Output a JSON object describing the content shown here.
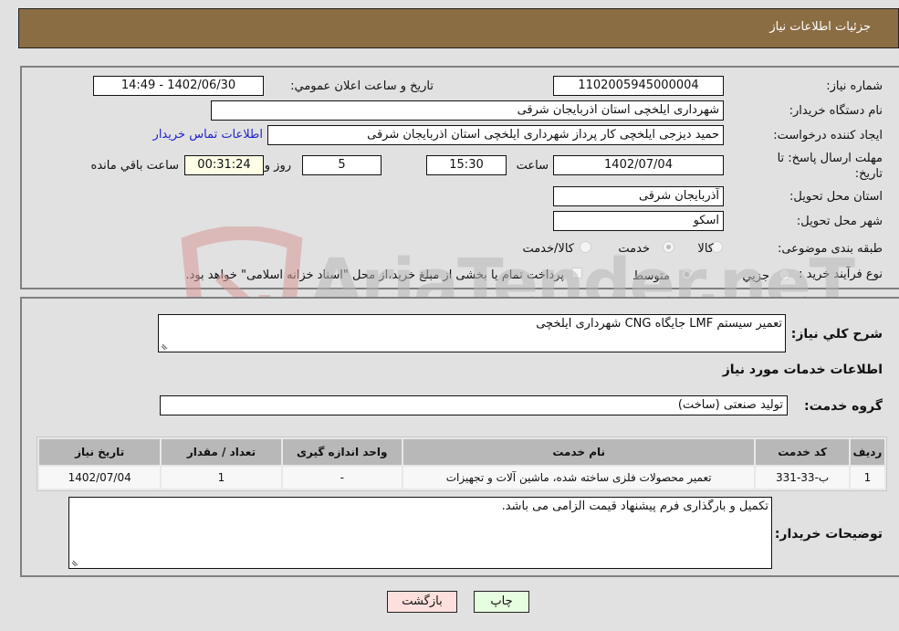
{
  "header": {
    "title": "جزئیات اطلاعات نیاز"
  },
  "form": {
    "need_number": {
      "label": "شماره نیاز:",
      "value": "1102005945000004"
    },
    "announce_datetime": {
      "label": "تاریخ و ساعت اعلان عمومي:",
      "value": "1402/06/30 - 14:49"
    },
    "buyer_org": {
      "label": "نام دستگاه خریدار:",
      "value": "شهرداری ایلخچی استان اذربایجان شرقی"
    },
    "requester": {
      "label": "ایجاد کننده درخواست:",
      "value": "حمید دیزجی ایلخچی کار پرداز شهرداری ایلخچی استان اذربایجان شرقی"
    },
    "buyer_contact_link": "اطلاعات تماس خریدار",
    "deadline": {
      "label_line1": "مهلت ارسال پاسخ: تا",
      "label_line2": "تاریخ:",
      "date": "1402/07/04",
      "time_label": "ساعت",
      "time": "15:30",
      "days": "5",
      "days_label": "روز و",
      "remaining": "00:31:24",
      "remaining_label": "ساعت باقي مانده"
    },
    "delivery_province": {
      "label": "استان محل تحویل:",
      "value": "آذربایجان شرقی"
    },
    "delivery_city": {
      "label": "شهر محل تحویل:",
      "value": "اسکو"
    },
    "category": {
      "label": "طبقه بندی موضوعی:",
      "options": [
        "کالا",
        "خدمت",
        "کالا/خدمت"
      ],
      "selected": "خدمت"
    },
    "purchase_type": {
      "label": "نوع فرآیند خرید :",
      "options": [
        "جزيي",
        "متوسط"
      ],
      "selected": "متوسط",
      "treasury_checkbox_label": "پرداخت تمام یا بخشی از مبلغ خرید،از محل \"اسناد خزانه اسلامی\" خواهد بود.",
      "treasury_checked": false
    }
  },
  "details": {
    "summary_label": "شرح کلي نیاز:",
    "summary_value": "تعمیر سیستم LMF جایگاه CNG شهرداری ایلخچی",
    "services_heading": "اطلاعات خدمات مورد نیاز",
    "service_group_label": "گروه خدمت:",
    "service_group_value": "تولید صنعتی (ساخت)",
    "table": {
      "headers": [
        "ردیف",
        "کد خدمت",
        "نام خدمت",
        "واحد اندازه گیری",
        "تعداد / مقدار",
        "تاریخ نیاز"
      ],
      "rows": [
        [
          "1",
          "ب-33-331",
          "تعمیر محصولات فلزی ساخته شده، ماشین آلات و تجهیزات",
          "-",
          "1",
          "1402/07/04"
        ]
      ]
    },
    "buyer_notes_label": "توضیحات خریدار:",
    "buyer_notes_value": "تکمیل و بارگذاری فرم پیشنهاد قیمت الزامی می باشد."
  },
  "buttons": {
    "print": "چاپ",
    "back": "بازگشت"
  },
  "watermark": {
    "text": "AriaTender.neT"
  },
  "colors": {
    "header_bg": "#8b6d43",
    "link": "#2222cc",
    "back_btn": "#fde0dd",
    "print_btn": "#e6fde0"
  }
}
